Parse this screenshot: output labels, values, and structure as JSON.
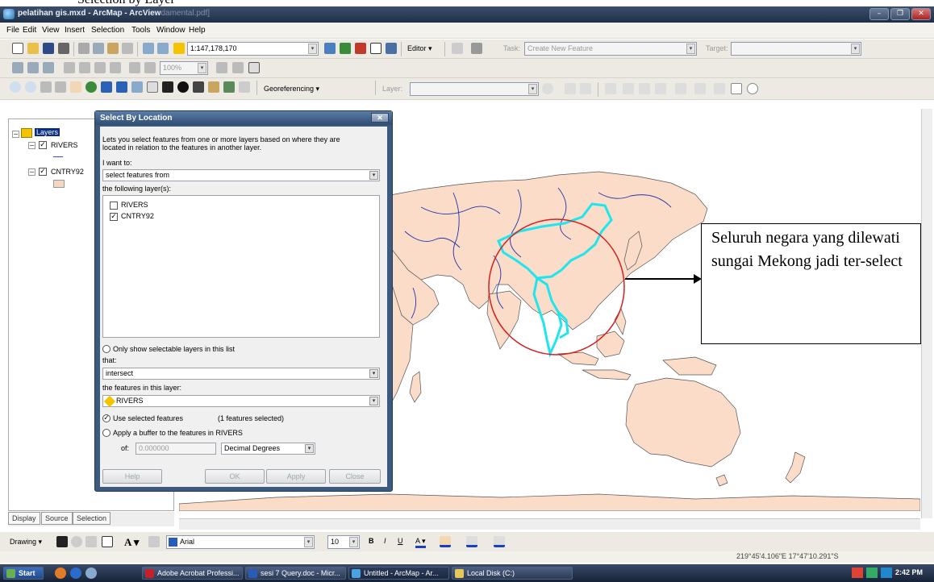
{
  "window": {
    "title": "pelatihan gis.mxd - ArcMap - ArcView",
    "behind_title": "damental.pdf]",
    "behind_top_text": "Selection by Layer"
  },
  "menu": [
    "File",
    "Edit",
    "View",
    "Insert",
    "Selection",
    "Tools",
    "Window",
    "Help"
  ],
  "toolbar": {
    "scale": "1:147,178,170",
    "editor": "Editor",
    "task_label": "Task:",
    "task_value": "Create New Feature",
    "target_label": "Target:",
    "zoom_pct": "100%",
    "georef": "Georeferencing",
    "layer_label": "Layer:"
  },
  "toc": {
    "root": "Layers",
    "layers": [
      "RIVERS",
      "CNTRY92"
    ],
    "tabs": [
      "Display",
      "Source",
      "Selection"
    ]
  },
  "dialog": {
    "title": "Select By Location",
    "description_1": "Lets you select features from one or more layers based on where they are",
    "description_2": "located in relation to the features in another layer.",
    "i_want_to_label": "I want to:",
    "i_want_to_value": "select features from",
    "following_layers_label": "the following layer(s):",
    "layers": [
      {
        "name": "RIVERS",
        "checked": false
      },
      {
        "name": "CNTRY92",
        "checked": true
      }
    ],
    "only_selectable": "Only show selectable layers in this list",
    "that_label": "that:",
    "that_value": "intersect",
    "features_in_layer_label": "the features in this layer:",
    "features_in_layer_value": "RIVERS",
    "use_selected": "Use selected features",
    "selected_count": "(1 features selected)",
    "apply_buffer": "Apply a buffer to the features in RIVERS",
    "of_label": "of:",
    "buffer_value": "0.000000",
    "buffer_units": "Decimal Degrees",
    "buttons": [
      "Help",
      "OK",
      "Apply",
      "Close"
    ]
  },
  "callout": {
    "text": "Seluruh negara yang dilewati sungai Mekong jadi ter-select"
  },
  "drawing_bar": {
    "drawing": "Drawing",
    "font": "Arial",
    "size": "10"
  },
  "status": {
    "coords": "219°45'4.106\"E  17°47'10.291\"S"
  },
  "taskbar": {
    "start": "Start",
    "tasks": [
      "Adobe Acrobat Professi...",
      "sesi 7 Query.doc - Micr...",
      "Untitled - ArcMap - Ar...",
      "Local Disk (C:)"
    ],
    "time": "2:42 PM"
  },
  "colors": {
    "land": "#fadcc8",
    "selection": "#1fe6ee",
    "rivers": "#2233aa"
  }
}
